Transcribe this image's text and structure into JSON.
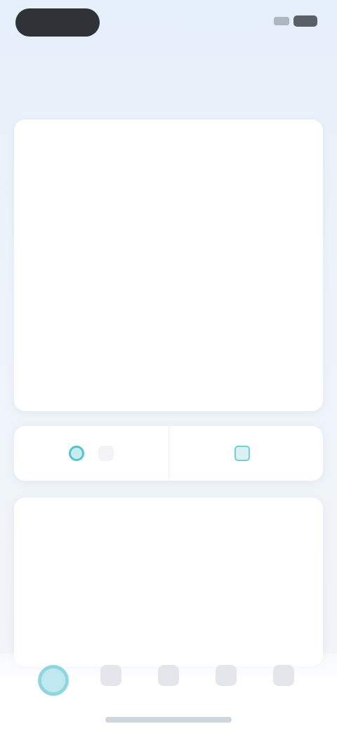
{
  "page": {
    "title": ""
  },
  "summary": {
    "rows": [
      {
        "label": "",
        "sub": "",
        "value": ""
      },
      {
        "label": "",
        "sub": "",
        "value": ""
      },
      {
        "label": "",
        "sub": "",
        "value": ""
      }
    ],
    "total": {
      "label": "",
      "sub": "",
      "value": "",
      "note_left": "",
      "note_right": ""
    }
  },
  "actions": [
    {
      "label": "",
      "icon": "circle-icon"
    },
    {
      "label": "",
      "icon": "tile-icon"
    }
  ],
  "details": {
    "title": "",
    "subtitle": "",
    "link": "",
    "columns": [
      "",
      "",
      "",
      ""
    ],
    "row": {
      "label": "",
      "cells": [
        "",
        "",
        "",
        ""
      ]
    }
  },
  "tabs": [
    {
      "label": "",
      "icon": "home-icon",
      "active": true
    },
    {
      "label": "",
      "icon": "tab-icon"
    },
    {
      "label": "",
      "icon": "tab-icon"
    },
    {
      "label": "",
      "icon": "tab-icon"
    },
    {
      "label": "",
      "icon": "tab-icon"
    }
  ],
  "colors": {
    "accent": "#46b9c4",
    "background": "#e6f0fa",
    "card": "#ffffff"
  }
}
